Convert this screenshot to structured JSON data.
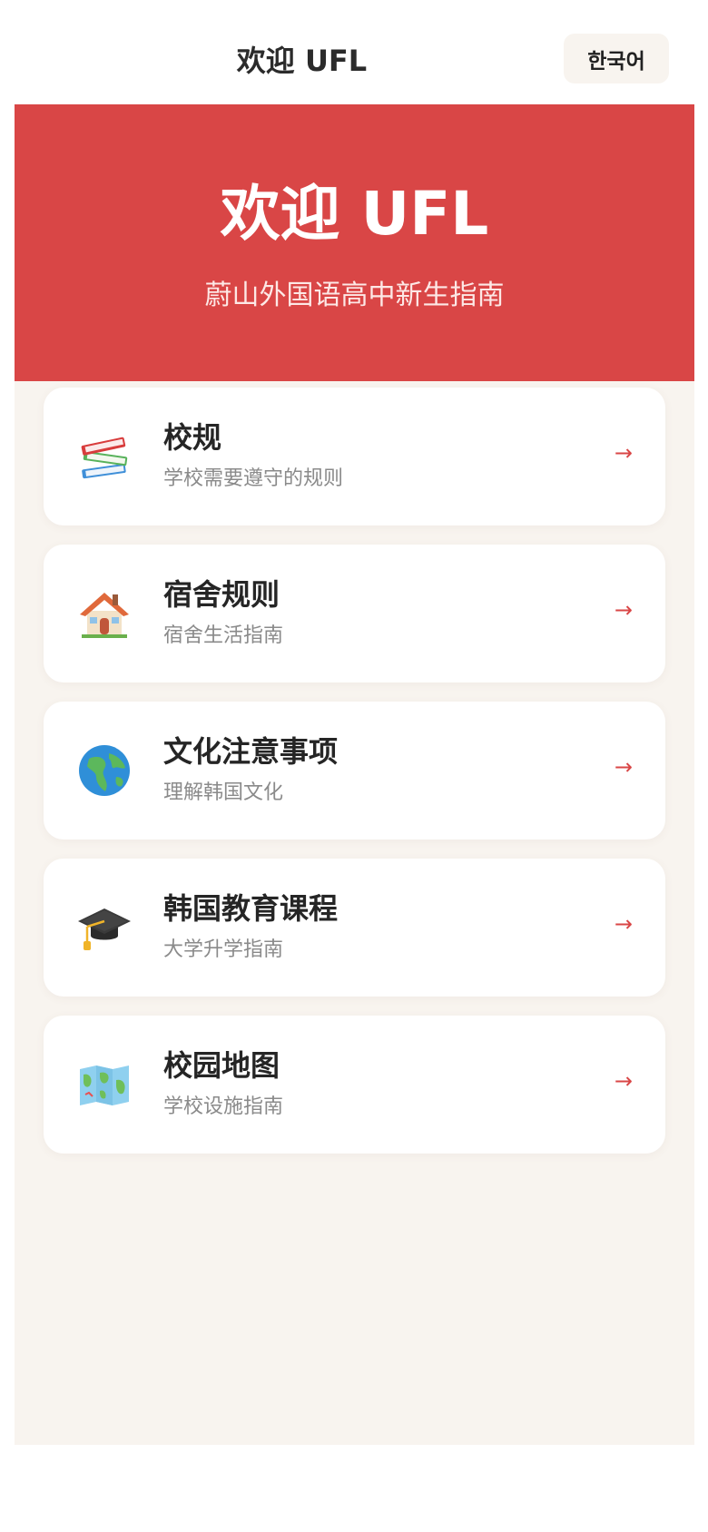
{
  "header": {
    "title": "欢迎 UFL",
    "language_button": "한국어"
  },
  "hero": {
    "title": "欢迎 UFL",
    "subtitle": "蔚山外国语高中新生指南"
  },
  "menu": {
    "items": [
      {
        "icon": "books-icon",
        "title": "校规",
        "description": "学校需要遵守的规则",
        "arrow": "→"
      },
      {
        "icon": "house-icon",
        "title": "宿舍规则",
        "description": "宿舍生活指南",
        "arrow": "→"
      },
      {
        "icon": "globe-icon",
        "title": "文化注意事项",
        "description": "理解韩国文化",
        "arrow": "→"
      },
      {
        "icon": "graduation-cap-icon",
        "title": "韩国教育课程",
        "description": "大学升学指南",
        "arrow": "→"
      },
      {
        "icon": "map-icon",
        "title": "校园地图",
        "description": "学校设施指南",
        "arrow": "→"
      }
    ]
  },
  "colors": {
    "accent": "#d94646",
    "background": "#f8f4ef",
    "card": "#ffffff"
  }
}
